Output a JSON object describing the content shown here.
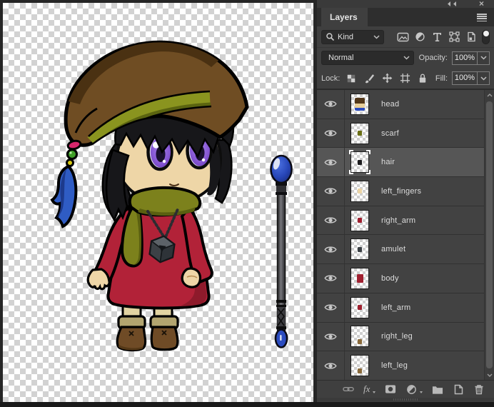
{
  "panel": {
    "tab_label": "Layers",
    "header": {
      "close_glyph": "×"
    },
    "filter": {
      "kind_label": "Kind"
    },
    "blend": {
      "mode": "Normal",
      "opacity_label": "Opacity:",
      "opacity_value": "100%"
    },
    "lock": {
      "label": "Lock:",
      "fill_label": "Fill:",
      "fill_value": "100%"
    },
    "layers": [
      {
        "name": "head",
        "selected": false,
        "thumb": "linear-gradient(180deg,#53381a 0%,#53381a 45%,#e8cf9a 45%,#e8cf9a 78%,#2b4cc0 78%)"
      },
      {
        "name": "scarf",
        "selected": false,
        "thumb": "#6b7016"
      },
      {
        "name": "hair",
        "selected": true,
        "thumb": "#1c1c1e"
      },
      {
        "name": "left_fingers",
        "selected": false,
        "thumb": "#ecd5a5"
      },
      {
        "name": "right_arm",
        "selected": false,
        "thumb": "#a02030"
      },
      {
        "name": "amulet",
        "selected": false,
        "thumb": "#3a3f44"
      },
      {
        "name": "body",
        "selected": false,
        "thumb": "#a02030"
      },
      {
        "name": "left_arm",
        "selected": false,
        "thumb": "#a02030"
      },
      {
        "name": "right_leg",
        "selected": false,
        "thumb": "#8a6a3a"
      },
      {
        "name": "left_leg",
        "selected": false,
        "thumb": "#8a6a3a"
      }
    ],
    "bottom_bar": {
      "fx_label": "fx"
    }
  },
  "canvas": {
    "checker_light": "#ffffff",
    "checker_dark": "#d2d2d2",
    "surround": "#262626",
    "artwork": {
      "description": "chibi witch character with beaded hat, feather, unity-cube amulet, and blue-orb staff",
      "palette": {
        "hat_brown": "#6f4d23",
        "hat_shadow": "#4a3112",
        "band_olive": "#8a941f",
        "band_shadow": "#5b6410",
        "hair_black": "#17171a",
        "skin": "#eed6a7",
        "skin_shadow": "#d9ba7e",
        "eye_purple": "#8859d6",
        "eye_purple_dark": "#6a3cb8",
        "scarf_olive": "#7c811c",
        "scarf_shadow": "#5a5f10",
        "dress_red": "#b22238",
        "dress_shadow": "#8e1a2b",
        "legs_cream": "#e2d4a2",
        "cuff_tan": "#b3a570",
        "boots_brown": "#6f4b26",
        "boots_shadow": "#543817",
        "feather_blue": "#2f5cc4",
        "feather_shadow": "#1d3a8c",
        "bead_pink": "#d6256b",
        "bead_green": "#3f9e26",
        "bead_yellow": "#d6c814",
        "orb_blue": "#2b4cc0",
        "amulet_gray": "#4a5056"
      }
    }
  }
}
